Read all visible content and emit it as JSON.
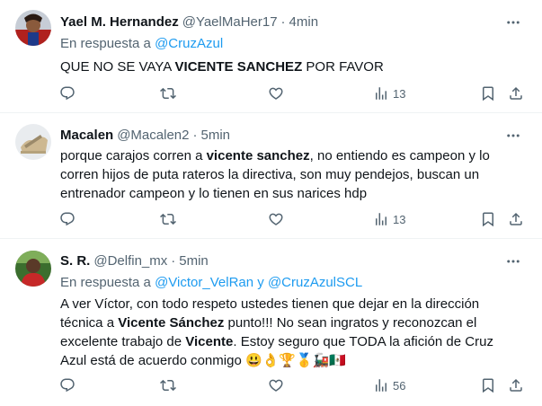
{
  "tweets": [
    {
      "name": "Yael M. Hernandez",
      "handle": "@YaelMaHer17",
      "dot": "·",
      "time": "4min",
      "reply_prefix": "En respuesta a",
      "reply_to": "@CruzAzul",
      "reply_join": "",
      "reply_to_2": "",
      "text": "QUE NO SE VAYA <b>VICENTE SANCHEZ</b> POR FAVOR",
      "views": "13"
    },
    {
      "name": "Macalen",
      "handle": "@Macalen2",
      "dot": "·",
      "time": "5min",
      "text": "porque carajos corren a <b>vicente sanchez</b>, no entiendo es campeon y lo corren hijos de puta rateros la directiva, son muy pendejos, buscan un entrenador campeon y lo tienen en sus narices hdp",
      "views": "13"
    },
    {
      "name": "S. R.",
      "handle": "@Delfin_mx",
      "dot": "·",
      "time": "5min",
      "reply_prefix": "En respuesta a",
      "reply_to": "@Victor_VelRan",
      "reply_join": "y",
      "reply_to_2": "@CruzAzulSCL",
      "text": "A ver Víctor, con todo respeto ustedes tienen que dejar en la dirección técnica a <b>Vicente Sánchez</b> punto!!! No sean ingratos y reconozcan el excelente trabajo de <b>Vicente</b>. Estoy seguro que TODA la afición de Cruz Azul está de acuerdo conmigo 😃👌🏆🥇🚂🇲🇽",
      "views": "56"
    }
  ],
  "icons": {
    "more": "more-icon",
    "reply": "reply-icon",
    "retweet": "retweet-icon",
    "like": "like-icon",
    "views": "views-icon",
    "bookmark": "bookmark-icon",
    "share": "share-icon"
  },
  "colors": {
    "link": "#1d9bf0",
    "secondary_text": "#536471",
    "divider": "#eff3f4"
  }
}
